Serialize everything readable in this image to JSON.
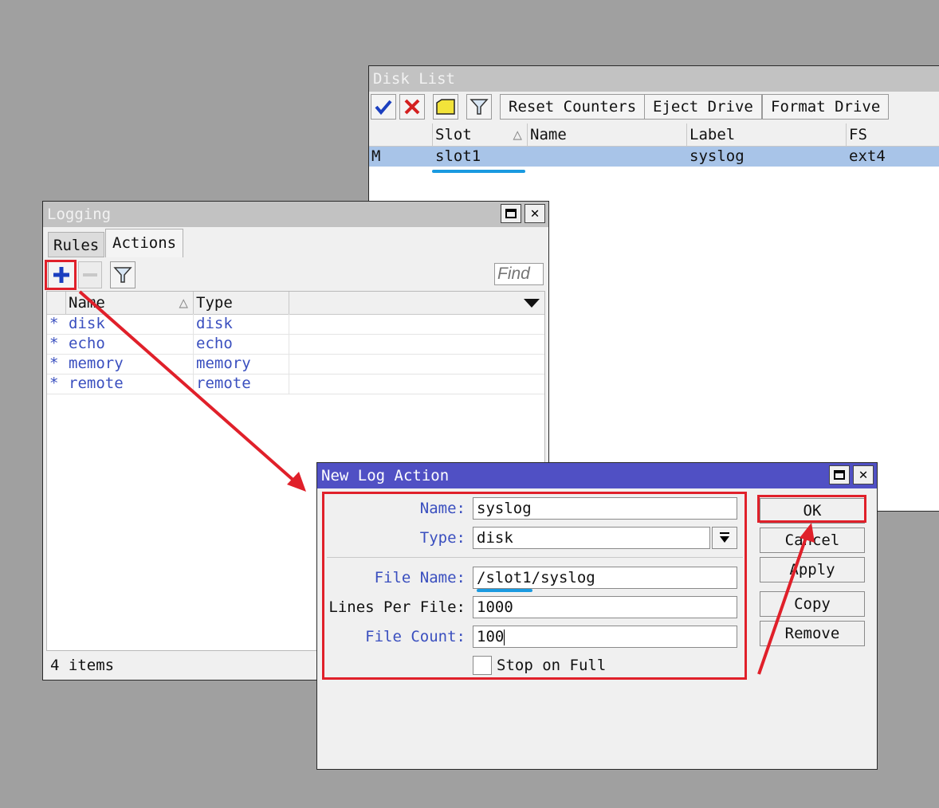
{
  "disk_list": {
    "title": "Disk List",
    "toolbar": {
      "enable_icon": "check-icon",
      "disable_icon": "x-icon",
      "comment_icon": "note-icon",
      "filter_icon": "filter-icon",
      "reset_counters": "Reset Counters",
      "eject_drive": "Eject Drive",
      "format_drive": "Format Drive"
    },
    "columns": [
      "Slot",
      "Name",
      "Label",
      "FS"
    ],
    "rows": [
      {
        "flag": "M",
        "slot": "slot1",
        "name": "",
        "label": "syslog",
        "fs": "ext4"
      }
    ]
  },
  "logging": {
    "title": "Logging",
    "tabs": [
      "Rules",
      "Actions"
    ],
    "active_tab": "Actions",
    "find_placeholder": "Find",
    "columns": [
      "Name",
      "Type"
    ],
    "rows": [
      {
        "flag": "*",
        "name": "disk",
        "type": "disk"
      },
      {
        "flag": "*",
        "name": "echo",
        "type": "echo"
      },
      {
        "flag": "*",
        "name": "memory",
        "type": "memory"
      },
      {
        "flag": "*",
        "name": "remote",
        "type": "remote"
      }
    ],
    "status": "4 items"
  },
  "new_log_action": {
    "title": "New Log Action",
    "fields": {
      "name_label": "Name:",
      "name_value": "syslog",
      "type_label": "Type:",
      "type_value": "disk",
      "file_name_label": "File Name:",
      "file_name_value": "/slot1/syslog",
      "lines_per_file_label": "Lines Per File:",
      "lines_per_file_value": "1000",
      "file_count_label": "File Count:",
      "file_count_value": "100",
      "stop_on_full_label": "Stop on Full"
    },
    "buttons": {
      "ok": "OK",
      "cancel": "Cancel",
      "apply": "Apply",
      "copy": "Copy",
      "remove": "Remove"
    }
  },
  "colors": {
    "annotation_red": "#e0202a",
    "underline_blue": "#1a9ae0",
    "selected_row": "#a8c4e8",
    "active_titlebar": "#5050c4",
    "link_text": "#3a4fbf"
  }
}
